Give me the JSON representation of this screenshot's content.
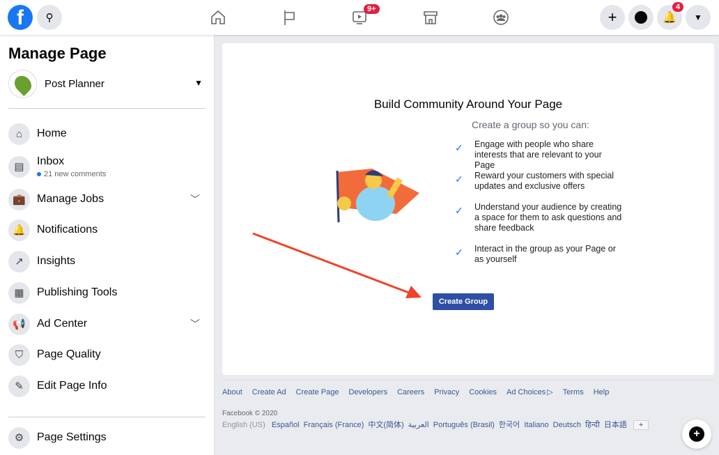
{
  "topbar": {
    "nav_icons": [
      "home-icon",
      "flag-icon",
      "watch-icon",
      "marketplace-icon",
      "groups-icon"
    ],
    "watch_badge": "9+",
    "notifications_badge": "4",
    "accent": "#1877f2",
    "badge_color": "#e41e3f"
  },
  "sidebar": {
    "title": "Manage Page",
    "page_name": "Post Planner",
    "items": [
      {
        "label": "Home"
      },
      {
        "label": "Inbox",
        "sub": "21 new comments"
      },
      {
        "label": "Manage Jobs"
      },
      {
        "label": "Notifications"
      },
      {
        "label": "Insights"
      },
      {
        "label": "Publishing Tools"
      },
      {
        "label": "Ad Center"
      },
      {
        "label": "Page Quality"
      },
      {
        "label": "Edit Page Info"
      },
      {
        "label": "Page Settings"
      }
    ]
  },
  "main": {
    "title": "Build Community Around Your Page",
    "subtitle": "Create a group so you can:",
    "benefits": [
      "Engage with people who share interests that are relevant to your Page",
      "Reward your customers with special updates and exclusive offers",
      "Understand your audience by creating a space for them to ask questions and share feedback",
      "Interact in the group as your Page or as yourself"
    ],
    "button": "Create Group"
  },
  "footer": {
    "links": [
      "About",
      "Create Ad",
      "Create Page",
      "Developers",
      "Careers",
      "Privacy",
      "Cookies",
      "Ad Choices",
      "Terms",
      "Help"
    ],
    "copyright": "Facebook © 2020",
    "current_language": "English (US)",
    "languages": [
      "Español",
      "Français (France)",
      "中文(简体)",
      "العربية",
      "Português (Brasil)",
      "한국어",
      "Italiano",
      "Deutsch",
      "हिन्दी",
      "日本語"
    ],
    "more": "+"
  }
}
